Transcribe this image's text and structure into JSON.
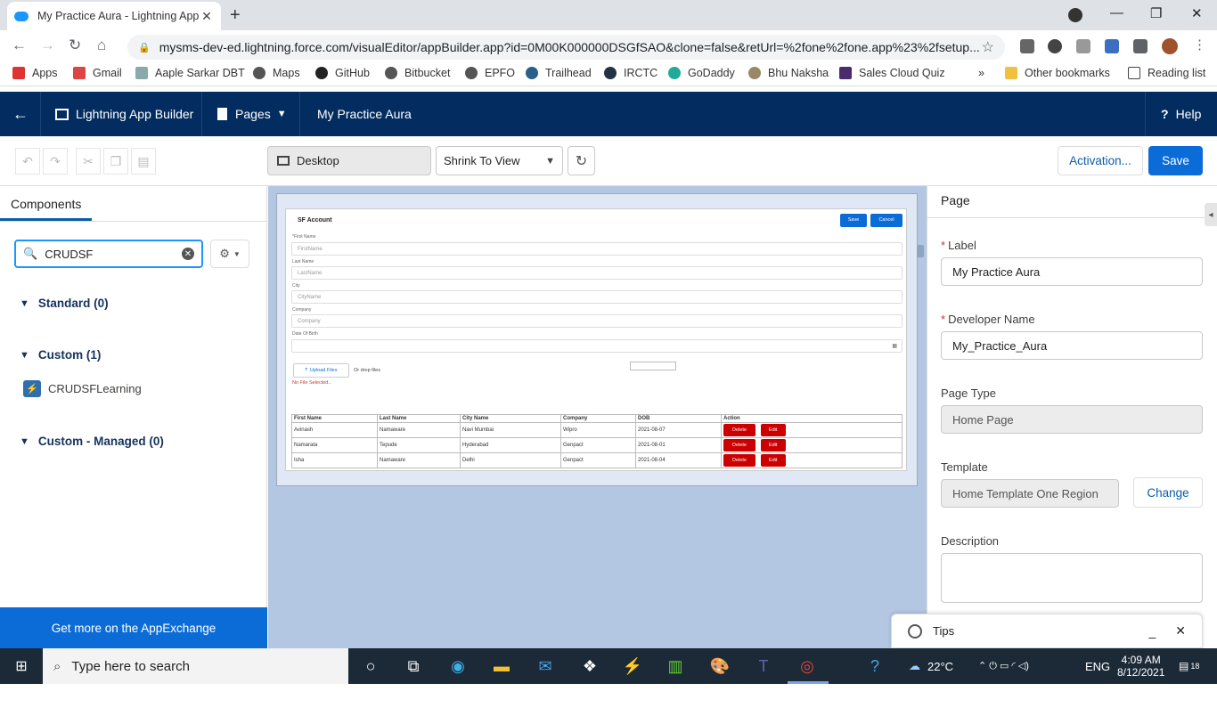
{
  "browser": {
    "tab_title": "My Practice Aura - Lightning App",
    "url": "mysms-dev-ed.lightning.force.com/visualEditor/appBuilder.app?id=0M00K000000DSGfSAO&clone=false&retUrl=%2fone%2fone.app%23%2fsetup...",
    "bookmarks": [
      "Apps",
      "Gmail",
      "Aaple Sarkar DBT",
      "Maps",
      "GitHub",
      "Bitbucket",
      "EPFO",
      "Trailhead",
      "IRCTC",
      "GoDaddy",
      "Bhu Naksha",
      "Sales Cloud Quiz"
    ],
    "more": "»",
    "other_bookmarks": "Other bookmarks",
    "reading_list": "Reading list"
  },
  "header": {
    "app_builder": "Lightning App Builder",
    "pages": "Pages",
    "page_name": "My Practice Aura",
    "help": "Help"
  },
  "toolbar": {
    "device": "Desktop",
    "zoom": "Shrink To View",
    "activation": "Activation...",
    "save": "Save"
  },
  "left": {
    "tab": "Components",
    "search_value": "CRUDSF",
    "sections": [
      {
        "label": "Standard (0)"
      },
      {
        "label": "Custom (1)"
      },
      {
        "label": "Custom - Managed (0)"
      }
    ],
    "custom_item": "CRUDSFLearning",
    "appexchange": "Get more on the AppExchange"
  },
  "preview": {
    "title": "SF Account",
    "save": "Save",
    "cancel": "Cancel",
    "fields": [
      {
        "label": "First Name",
        "placeholder": "FirstName"
      },
      {
        "label": "Last Name",
        "placeholder": "LastName"
      },
      {
        "label": "City",
        "placeholder": "CityName"
      },
      {
        "label": "Company",
        "placeholder": "Company"
      },
      {
        "label": "Date Of Birth",
        "placeholder": ""
      }
    ],
    "upload": "Upload Files",
    "drop": "Or drop files",
    "no_file": "No File Selected..",
    "columns": [
      "First Name",
      "Last Name",
      "City Name",
      "Company",
      "DOB",
      "Action"
    ],
    "rows": [
      [
        "Avinash",
        "Namaware",
        "Navi Mumbai",
        "Wipro",
        "2021-08-07"
      ],
      [
        "Namarata",
        "Tepude",
        "Hyderabad",
        "Genpact",
        "2021-08-01"
      ],
      [
        "Isha",
        "Namaware",
        "Delhi",
        "Genpact",
        "2021-08-04"
      ]
    ],
    "delete": "Delete",
    "edit": "Edit"
  },
  "right": {
    "title": "Page",
    "label_label": "Label",
    "label_value": "My Practice Aura",
    "dev_label": "Developer Name",
    "dev_value": "My_Practice_Aura",
    "type_label": "Page Type",
    "type_value": "Home Page",
    "template_label": "Template",
    "template_value": "Home Template One Region",
    "change": "Change",
    "desc_label": "Description",
    "tips": "Tips"
  },
  "taskbar": {
    "search": "Type here to search",
    "temp": "22°C",
    "lang": "ENG",
    "time": "4:09 AM",
    "date": "8/12/2021",
    "notif": "18"
  }
}
